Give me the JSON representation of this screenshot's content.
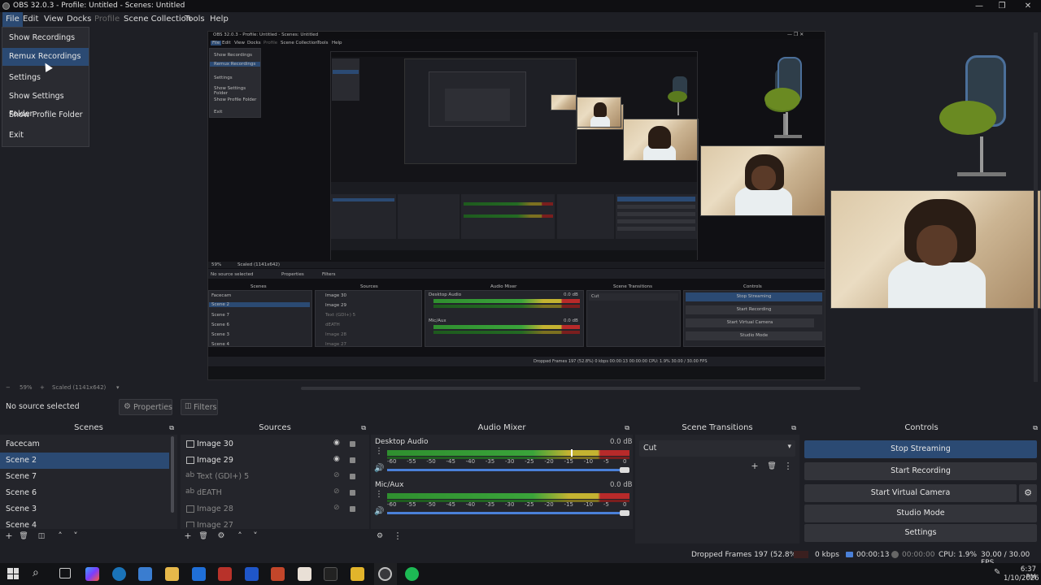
{
  "window": {
    "title": "OBS 32.0.3 - Profile: Untitled - Scenes: Untitled",
    "controls": [
      "—",
      "❐",
      "✕"
    ]
  },
  "menu": {
    "items": [
      "File",
      "Edit",
      "View",
      "Docks",
      "Profile",
      "Scene Collection",
      "Tools",
      "Help"
    ],
    "file_dropdown": [
      "Show Recordings",
      "Remux Recordings",
      "Settings",
      "Show Settings Folder",
      "Show Profile Folder",
      "Exit"
    ]
  },
  "nested": {
    "title": "OBS 32.0.3 - Profile: Untitled - Scenes: Untitled",
    "menu": [
      "File",
      "Edit",
      "View",
      "Docks",
      "Profile",
      "Scene Collection",
      "Tools",
      "Help"
    ],
    "dropdown": [
      "Show Recordings",
      "Remux Recordings",
      "Settings",
      "Show Settings Folder",
      "Show Profile Folder",
      "Exit"
    ],
    "no_source": "No source selected",
    "properties": "Properties",
    "filters": "Filters",
    "headers": [
      "Scenes",
      "Sources",
      "Audio Mixer",
      "Scene Transitions",
      "Controls"
    ],
    "scenes": [
      "Facecam",
      "Scene 2",
      "Scene 7",
      "Scene 6",
      "Scene 3",
      "Scene 4"
    ],
    "sources": [
      "Image 30",
      "Image 29",
      "Text (GDI+) 5",
      "dEATH",
      "Image 28",
      "Image 27"
    ],
    "audio": [
      "Desktop Audio",
      "Mic/Aux"
    ],
    "db": "0.0 dB",
    "transition": "Cut",
    "controls": [
      "Stop Streaming",
      "Start Recording",
      "Start Virtual Camera",
      "Studio Mode",
      "Settings"
    ],
    "status": "Dropped Frames 197 (52.8%)    0 kbps    00:00:13    00:00:00    CPU: 1.9%    30.00 / 30.00 FPS",
    "scale": "59%",
    "scaled": "Scaled (1141x642)"
  },
  "preview": {
    "zoom_minus": "−",
    "zoom": "59%",
    "zoom_plus": "+",
    "scaled": "Scaled (1141x642)"
  },
  "source_bar": {
    "no_source": "No source selected",
    "properties": "Properties",
    "filters": "Filters"
  },
  "docks": {
    "scenes": {
      "title": "Scenes",
      "items": [
        "Facecam",
        "Scene 2",
        "Scene 7",
        "Scene 6",
        "Scene 3",
        "Scene 4"
      ],
      "selected": "Scene 2"
    },
    "sources": {
      "title": "Sources",
      "items": [
        {
          "name": "Image 30",
          "visible": true
        },
        {
          "name": "Image 29",
          "visible": true
        },
        {
          "name": "Text (GDI+) 5",
          "visible": false
        },
        {
          "name": "dEATH",
          "visible": false
        },
        {
          "name": "Image 28",
          "visible": false
        },
        {
          "name": "Image 27",
          "visible": false
        }
      ]
    },
    "audio_mixer": {
      "title": "Audio Mixer",
      "channels": [
        {
          "name": "Desktop Audio",
          "db": "0.0 dB"
        },
        {
          "name": "Mic/Aux",
          "db": "0.0 dB"
        }
      ],
      "scale": [
        "-60",
        "-55",
        "-50",
        "-45",
        "-40",
        "-35",
        "-30",
        "-25",
        "-20",
        "-15",
        "-10",
        "-5",
        "0"
      ]
    },
    "scene_transitions": {
      "title": "Scene Transitions",
      "selected": "Cut"
    },
    "controls": {
      "title": "Controls",
      "buttons": [
        "Stop Streaming",
        "Start Recording",
        "Start Virtual Camera",
        "Studio Mode",
        "Settings"
      ]
    }
  },
  "status": {
    "dropped": "Dropped Frames 197 (52.8%)",
    "kbps": "0 kbps",
    "stream_time": "00:00:13",
    "rec_time": "00:00:00",
    "cpu": "CPU: 1.9%",
    "fps": "30.00 / 30.00 FPS"
  },
  "taskbar": {
    "time": "6:37 PM",
    "date": "1/10/2026"
  },
  "colors": {
    "accent": "#2b4a73",
    "background": "#1e1f25",
    "panel": "#24252b"
  }
}
